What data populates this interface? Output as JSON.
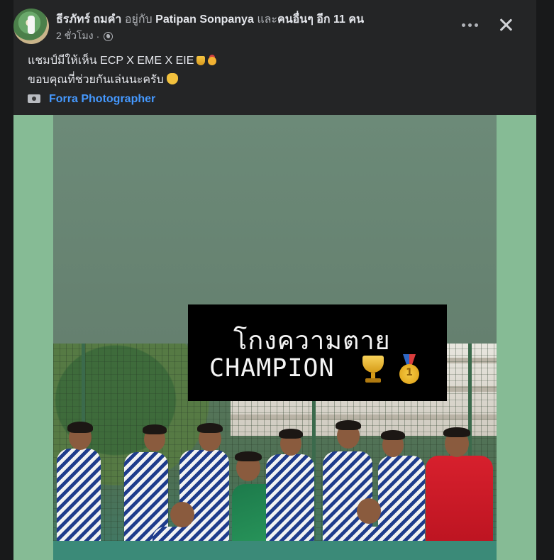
{
  "post": {
    "author": "ธีรภัทร์ ถมคำ",
    "with_prefix": "อยู่กับ",
    "tagged_person": "Patipan Sonpanya",
    "and_word": "และ",
    "others": "คนอื่นๆ อีก 11 คน",
    "time": "2 ชั่วโมง",
    "separator": "·",
    "privacy_icon": "globe-icon",
    "more_icon": "more-horizontal-icon",
    "close_icon": "close-icon"
  },
  "caption": {
    "line1": "แชมป์มีให้เห็น ECP X EME X EIE",
    "line1_emojis": [
      "trophy-icon",
      "gold-medal-icon"
    ],
    "line2": "ขอบคุณที่ช่วยกันเล่นนะครับ",
    "line2_emoji": "folded-hands-icon",
    "line3_icon": "camera-icon",
    "line3_link": "Forra Photographer"
  },
  "photo": {
    "banner_line1": "โกงความตาย",
    "banner_line2": "CHAMPION",
    "banner_emojis": [
      "trophy-icon",
      "gold-medal-icon"
    ],
    "medal_number": "1"
  },
  "colors": {
    "background": "#18191a",
    "card": "#242526",
    "text": "#e4e6eb",
    "muted": "#b0b3b8",
    "link": "#4599ff",
    "media_bg": "#86bb95"
  }
}
